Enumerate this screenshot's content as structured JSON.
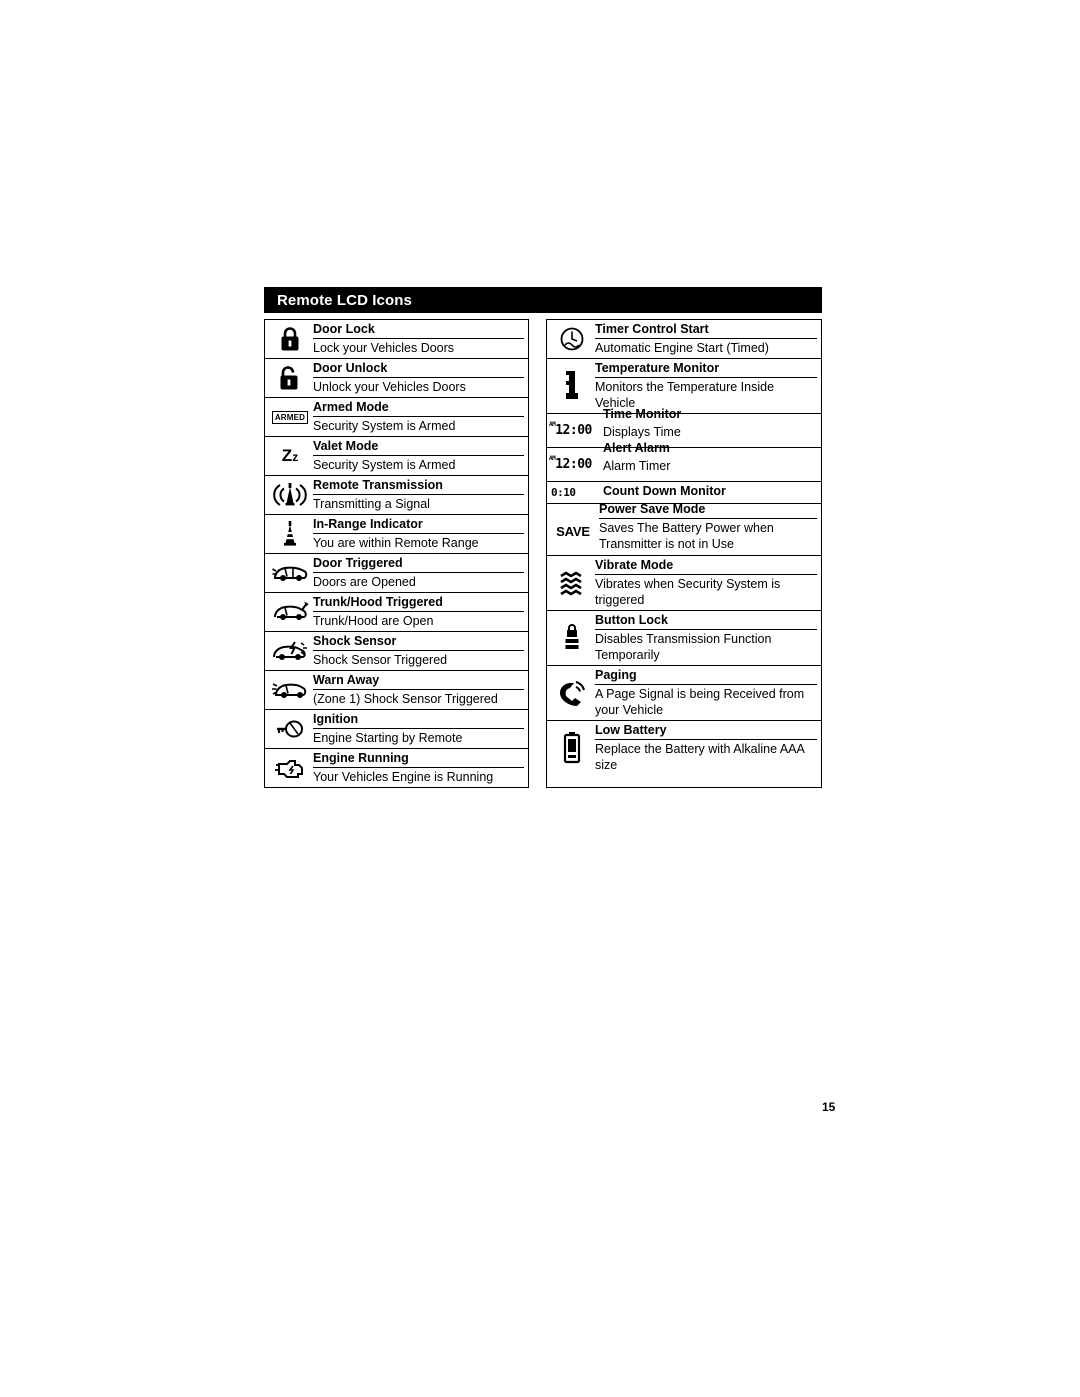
{
  "section": {
    "header_title": "Remote LCD Icons"
  },
  "page_number": "15",
  "left_column": [
    {
      "icon": "door-lock-padlock-icon",
      "title": "Door Lock",
      "desc": "Lock your Vehicles Doors"
    },
    {
      "icon": "door-unlock-open-padlock-icon",
      "title": "Door Unlock",
      "desc": "Unlock your Vehicles Doors"
    },
    {
      "icon": "armed-mode-badge-icon",
      "icon_text": "ARMED",
      "title": "Armed Mode",
      "desc": "Security System is Armed"
    },
    {
      "icon": "valet-mode-zzz-icon",
      "icon_text": "Z z",
      "title": "Valet Mode",
      "desc": "Security System is Armed"
    },
    {
      "icon": "remote-transmission-antenna-icon",
      "title": "Remote Transmission",
      "desc": "Transmitting a Signal"
    },
    {
      "icon": "in-range-indicator-tower-icon",
      "title": "In-Range Indicator",
      "desc": "You are within Remote Range"
    },
    {
      "icon": "door-triggered-car-icon",
      "title": "Door Triggered",
      "desc": "Doors are Opened"
    },
    {
      "icon": "trunk-hood-triggered-car-icon",
      "title": "Trunk/Hood Triggered",
      "desc": "Trunk/Hood are Open"
    },
    {
      "icon": "shock-sensor-car-icon",
      "title": "Shock Sensor",
      "desc": "Shock Sensor Triggered"
    },
    {
      "icon": "warn-away-car-icon",
      "title": "Warn Away",
      "desc": "(Zone 1) Shock Sensor Triggered"
    },
    {
      "icon": "ignition-key-icon",
      "title": "Ignition",
      "desc": "Engine Starting by Remote"
    },
    {
      "icon": "engine-running-icon",
      "title": "Engine Running",
      "desc": "Your Vehicles Engine is Running"
    }
  ],
  "right_column": [
    {
      "icon": "timer-control-start-clock-icon",
      "title": "Timer Control Start",
      "desc": "Automatic Engine Start (Timed)"
    },
    {
      "icon": "temperature-monitor-thermometer-icon",
      "title": "Temperature Monitor",
      "desc": "Monitors the Temperature Inside Vehicle"
    },
    {
      "icon": "time-monitor-lcd-icon",
      "icon_text": "12:00",
      "icon_prefix": "AM",
      "title": "Time Monitor",
      "desc": "Displays Time"
    },
    {
      "icon": "alert-alarm-lcd-icon",
      "icon_text": "12:00",
      "icon_prefix": "AM",
      "title": "Alert Alarm",
      "desc": "Alarm Timer"
    },
    {
      "icon": "count-down-monitor-lcd-icon",
      "icon_text": "0:10",
      "title": "Count Down Monitor",
      "desc": ""
    },
    {
      "icon": "power-save-mode-icon",
      "icon_text": "SAVE",
      "title": "Power Save Mode",
      "desc": "Saves The Battery Power when Transmitter is not in Use"
    },
    {
      "icon": "vibrate-mode-waves-icon",
      "title": "Vibrate Mode",
      "desc": "Vibrates when Security System is triggered"
    },
    {
      "icon": "button-lock-icon",
      "title": "Button Lock",
      "desc": "Disables Transmission Function Temporarily"
    },
    {
      "icon": "paging-phone-icon",
      "title": "Paging",
      "desc": "A Page Signal is being Received from your Vehicle"
    },
    {
      "icon": "low-battery-icon",
      "title": "Low Battery",
      "desc": "Replace the Battery with Alkaline AAA size"
    }
  ]
}
